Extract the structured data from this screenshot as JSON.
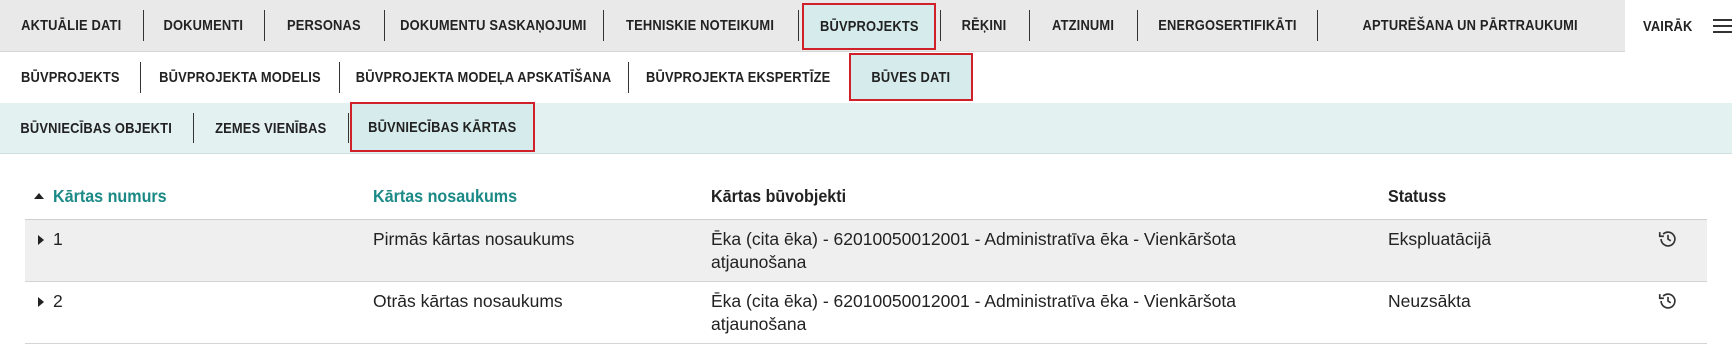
{
  "nav_primary": {
    "tabs": [
      {
        "label": "AKTUĀLIE DATI"
      },
      {
        "label": "DOKUMENTI"
      },
      {
        "label": "PERSONAS"
      },
      {
        "label": "DOKUMENTU SASKAŅOJUMI"
      },
      {
        "label": "TEHNISKIE NOTEIKUMI"
      },
      {
        "label": "BŪVPROJEKTS",
        "active": true
      },
      {
        "label": "RĒĶINI"
      },
      {
        "label": "ATZINUMI"
      },
      {
        "label": "ENERGOSERTIFIKĀTI"
      },
      {
        "label": "APTURĒŠANA UN PĀRTRAUKUMI"
      }
    ],
    "more_label": "VAIRĀK",
    "more_icon": "hamburger-icon"
  },
  "nav_secondary": {
    "tabs": [
      {
        "label": "BŪVPROJEKTS"
      },
      {
        "label": "BŪVPROJEKTA MODELIS"
      },
      {
        "label": "BŪVPROJEKTA MODEĻA APSKATĪŠANA"
      },
      {
        "label": "BŪVPROJEKTA EKSPERTĪZE"
      },
      {
        "label": "BŪVES DATI",
        "active": true
      }
    ]
  },
  "nav_tertiary": {
    "tabs": [
      {
        "label": "BŪVNIECĪBAS OBJEKTI"
      },
      {
        "label": "ZEMES VIENĪBAS"
      },
      {
        "label": "BŪVNIECĪBAS KĀRTAS",
        "active": true
      }
    ]
  },
  "table": {
    "columns": {
      "number": "Kārtas numurs",
      "name": "Kārtas nosaukums",
      "objects": "Kārtas būvobjekti",
      "status": "Statuss"
    },
    "sort_icon": "sort-ascending-icon",
    "rows": [
      {
        "number": "1",
        "name": "Pirmās kārtas nosaukums",
        "objects_line1": "Ēka (cita ēka) - 62010050012001 - Administratīva ēka - Vienkāršota",
        "objects_line2": "atjaunošana",
        "status": "Ekspluatācijā"
      },
      {
        "number": "2",
        "name": "Otrās kārtas nosaukums",
        "objects_line1": "Ēka (cita ēka) - 62010050012001 - Administratīva ēka - Vienkāršota",
        "objects_line2": "atjaunošana",
        "status": "Neuzsākta"
      }
    ],
    "row_action_icon": "history-icon"
  },
  "colors": {
    "accent_teal": "#1b8a86",
    "highlight_red": "#d0202a",
    "active_tab_bg": "#d6ecec"
  }
}
